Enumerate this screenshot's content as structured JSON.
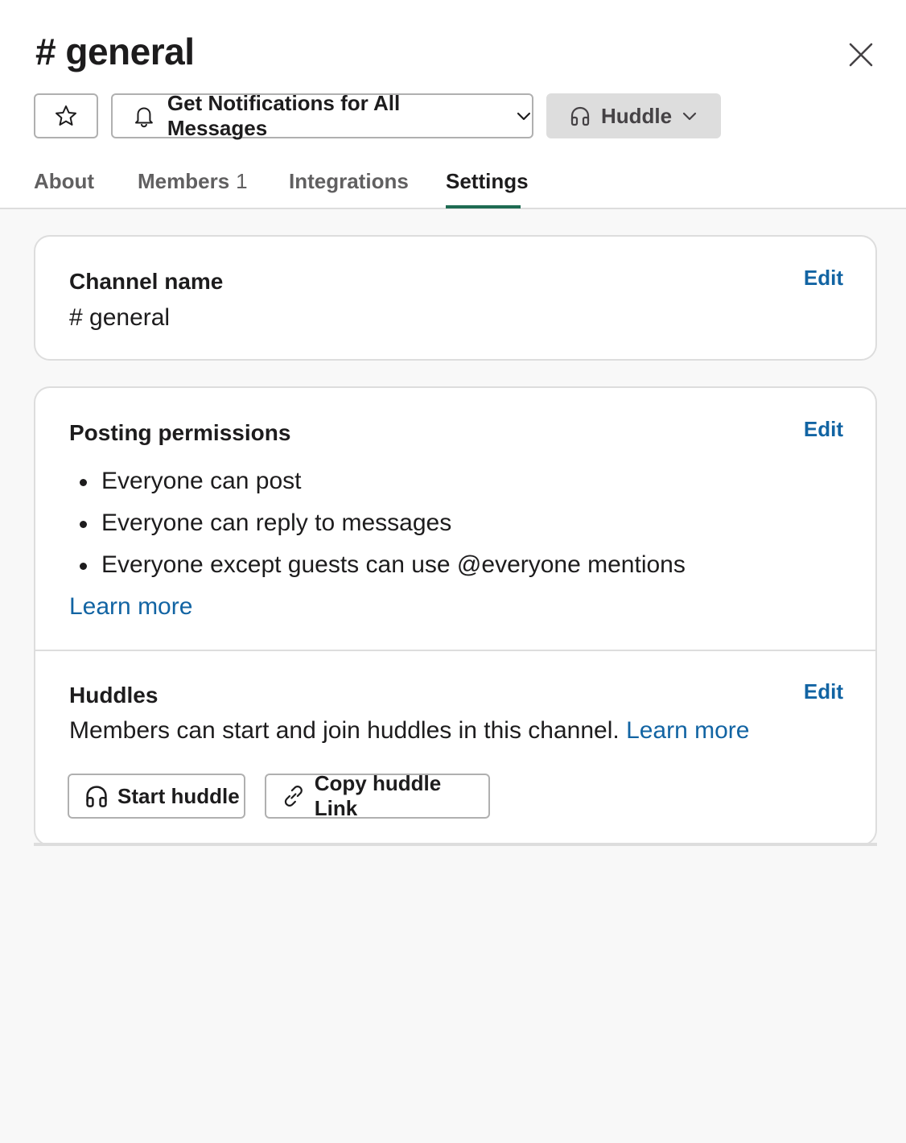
{
  "header": {
    "title": "# general",
    "notifications_label": "Get Notifications for All Messages",
    "huddle_label": "Huddle"
  },
  "icons": {
    "close": "close-icon",
    "star": "star-icon",
    "bell": "bell-icon",
    "headphones": "headphones-icon",
    "chevron": "chevron-down-icon",
    "link": "link-icon"
  },
  "tabs": [
    {
      "label": "About",
      "count": ""
    },
    {
      "label": "Members",
      "count": "1"
    },
    {
      "label": "Integrations",
      "count": ""
    },
    {
      "label": "Settings",
      "count": ""
    }
  ],
  "active_tab": "Settings",
  "channel_name": {
    "title": "Channel name",
    "value": "# general",
    "edit_label": "Edit"
  },
  "posting_permissions": {
    "title": "Posting permissions",
    "edit_label": "Edit",
    "items": [
      "Everyone can post",
      "Everyone can reply to messages",
      "Everyone except guests can use @everyone mentions"
    ],
    "learn_more": "Learn more"
  },
  "huddles": {
    "title": "Huddles",
    "edit_label": "Edit",
    "description": "Members can start and join huddles in this channel.",
    "learn_more": "Learn more",
    "start_label": "Start huddle",
    "copy_label": "Copy huddle Link"
  },
  "colors": {
    "accent_link": "#1264a3",
    "active_tab_underline": "#1e6b52",
    "background": "#f8f8f8"
  }
}
